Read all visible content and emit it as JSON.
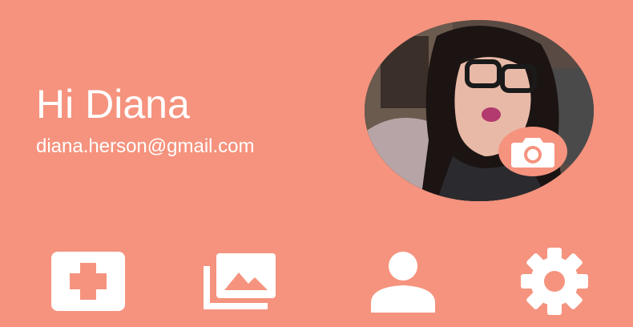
{
  "profile": {
    "greeting": "Hi Diana",
    "email": "diana.herson@gmail.com"
  },
  "icons": {
    "avatar": "user-photo",
    "camera": "camera-icon",
    "nav": [
      "add-icon",
      "gallery-icon",
      "person-icon",
      "settings-icon"
    ]
  },
  "colors": {
    "background": "#F5937E",
    "foreground": "#FFFFFF"
  }
}
